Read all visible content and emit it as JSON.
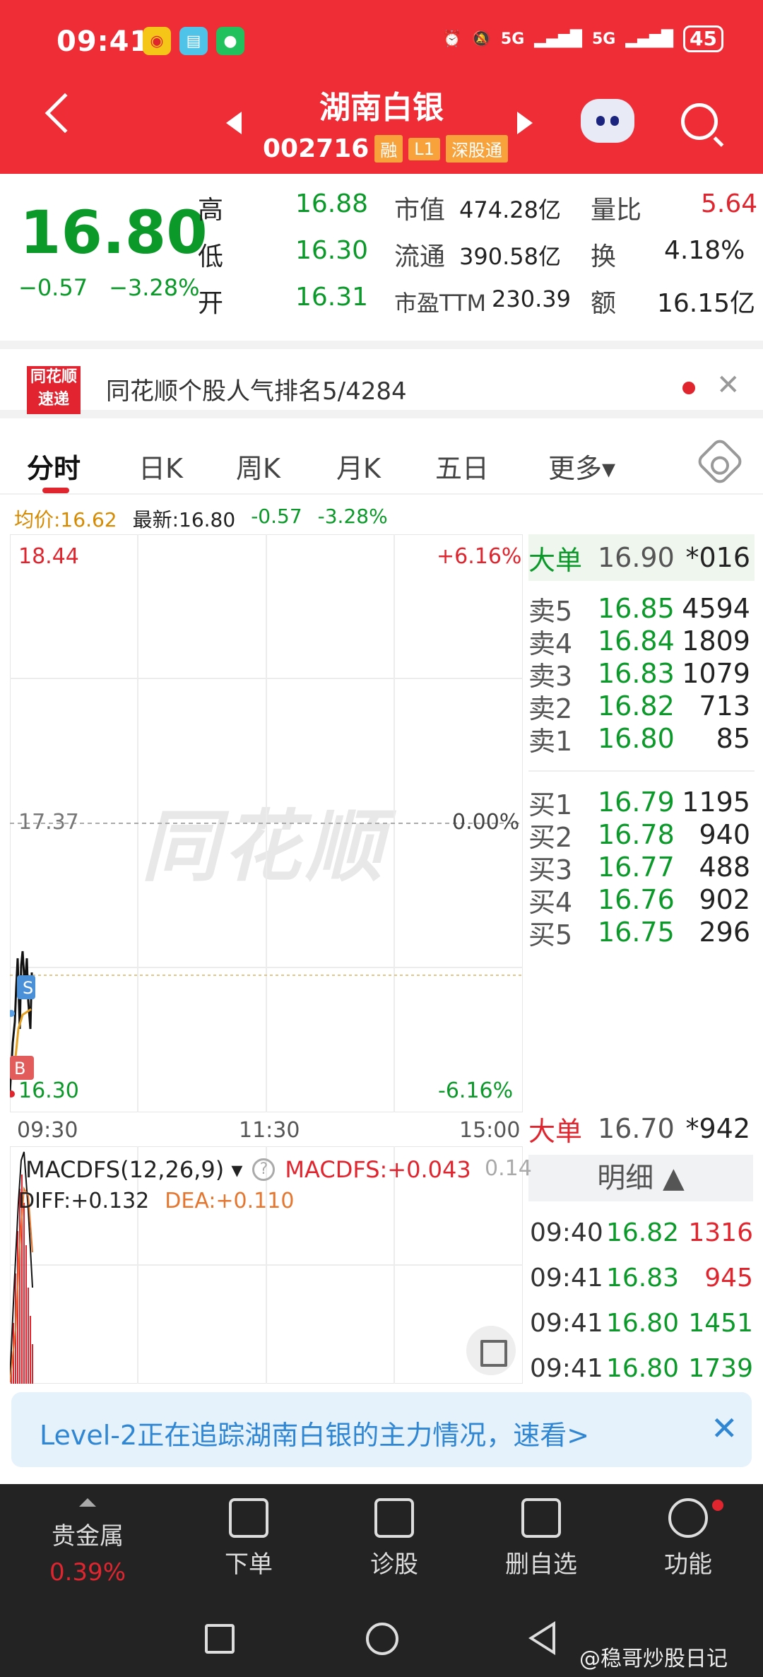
{
  "status_bar": {
    "time": "09:41",
    "battery": "45",
    "net1": "5G",
    "net2": "5G"
  },
  "header": {
    "title": "湖南白银",
    "code": "002716",
    "tag_small": "融",
    "tag_l1": "L1",
    "tag_market": "深股通"
  },
  "quote": {
    "price": "16.80",
    "change": "−0.57",
    "change_pct": "−3.28%",
    "rows": [
      {
        "l1": "高",
        "v1": "16.88",
        "l2": "市值",
        "v2": "474.28亿",
        "l3": "量比",
        "v3": "5.64"
      },
      {
        "l1": "低",
        "v1": "16.30",
        "l2": "流通",
        "v2": "390.58亿",
        "l3": "换",
        "v3": "4.18%"
      },
      {
        "l1": "开",
        "v1": "16.31",
        "l2": "市盈TTM",
        "v2": "230.39",
        "l3": "额",
        "v3": "16.15亿"
      }
    ]
  },
  "rank": {
    "logo_top": "同花顺",
    "logo_bottom": "速递",
    "text": "同花顺个股人气排名5/4284"
  },
  "tabs": [
    "分时",
    "日K",
    "周K",
    "月K",
    "五日",
    "更多▾"
  ],
  "info_line": {
    "avg": "均价:16.62",
    "latest": "最新:16.80",
    "chg": "-0.57",
    "pct": "-3.28%"
  },
  "chart": {
    "top_price": "18.44",
    "top_pct": "+6.16%",
    "mid_price": "17.37",
    "mid_pct": "0.00%",
    "bottom_price": "16.30",
    "bottom_pct": "-6.16%",
    "watermark": "同花顺",
    "times": [
      "09:30",
      "11:30",
      "15:00"
    ],
    "marker_s": "S",
    "marker_b": "B"
  },
  "book": {
    "big_top": {
      "label": "大单",
      "price": "16.90",
      "vol": "*016"
    },
    "sells": [
      {
        "label": "卖5",
        "price": "16.85",
        "vol": "4594"
      },
      {
        "label": "卖4",
        "price": "16.84",
        "vol": "1809"
      },
      {
        "label": "卖3",
        "price": "16.83",
        "vol": "1079"
      },
      {
        "label": "卖2",
        "price": "16.82",
        "vol": "713"
      },
      {
        "label": "卖1",
        "price": "16.80",
        "vol": "85"
      }
    ],
    "buys": [
      {
        "label": "买1",
        "price": "16.79",
        "vol": "1195"
      },
      {
        "label": "买2",
        "price": "16.78",
        "vol": "940"
      },
      {
        "label": "买3",
        "price": "16.77",
        "vol": "488"
      },
      {
        "label": "买4",
        "price": "16.76",
        "vol": "902"
      },
      {
        "label": "买5",
        "price": "16.75",
        "vol": "296"
      }
    ],
    "big_bottom": {
      "label": "大单",
      "price": "16.70",
      "vol": "*942"
    },
    "detail_label": "明细 ▲",
    "trades": [
      {
        "t": "09:40",
        "p": "16.82",
        "v": "1316"
      },
      {
        "t": "09:41",
        "p": "16.83",
        "v": "945"
      },
      {
        "t": "09:41",
        "p": "16.80",
        "v": "1451"
      },
      {
        "t": "09:41",
        "p": "16.80",
        "v": "1739"
      }
    ]
  },
  "macd": {
    "name": "MACDFS(12,26,9) ▾",
    "value": "MACDFS:+0.043",
    "right_value": "0.14",
    "diff": "DIFF:+0.132",
    "dea": "DEA:+0.110"
  },
  "level2": {
    "text": "Level-2正在追踪湖南白银的主力情况，速看>"
  },
  "bottom_bar": {
    "sector": "贵金属",
    "sector_pct": "0.39%",
    "items": [
      "下单",
      "诊股",
      "删自选",
      "功能"
    ]
  },
  "credit": "@稳哥炒股日记",
  "colors": {
    "header": "#ef2d37",
    "down": "#0b9a2a",
    "up": "#e0252f"
  }
}
